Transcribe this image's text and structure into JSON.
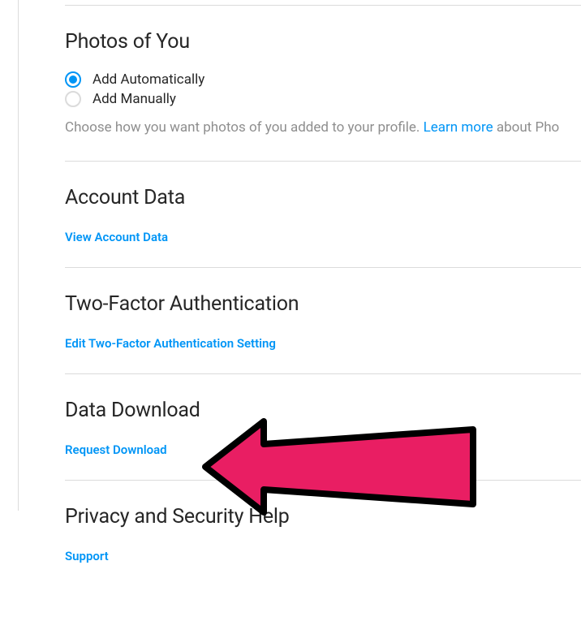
{
  "sections": {
    "photos_of_you": {
      "heading": "Photos of You",
      "options": [
        {
          "label": "Add Automatically",
          "checked": true
        },
        {
          "label": "Add Manually",
          "checked": false
        }
      ],
      "help_prefix": "Choose how you want photos of you added to your profile. ",
      "help_link": "Learn more",
      "help_suffix": " about Pho"
    },
    "account_data": {
      "heading": "Account Data",
      "link": "View Account Data"
    },
    "two_factor": {
      "heading": "Two-Factor Authentication",
      "link": "Edit Two-Factor Authentication Setting"
    },
    "data_download": {
      "heading": "Data Download",
      "link": "Request Download"
    },
    "privacy_help": {
      "heading": "Privacy and Security Help",
      "link": "Support"
    }
  }
}
